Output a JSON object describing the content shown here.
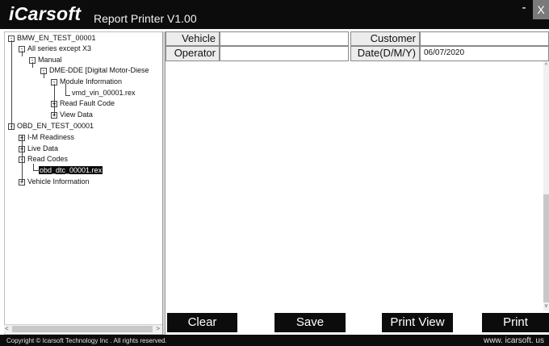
{
  "header": {
    "brand": "iCarsoft",
    "app_title": "Report Printer V1.00",
    "minimize_label": "-",
    "close_label": "X"
  },
  "tree": {
    "items": [
      {
        "label": "BMW_EN_TEST_00001",
        "toggle": "⊟"
      },
      {
        "label": "All series except X3",
        "toggle": "⊟"
      },
      {
        "label": "Manual",
        "toggle": "⊟"
      },
      {
        "label": "DME-DDE [Digital Motor-Diese",
        "toggle": "⊟"
      },
      {
        "label": "Module Information",
        "toggle": "⊟"
      },
      {
        "label": "vmd_vin_00001.rex",
        "toggle": ""
      },
      {
        "label": "Read Fault Code",
        "toggle": "⊞"
      },
      {
        "label": "View Data",
        "toggle": "⊞"
      },
      {
        "label": "OBD_EN_TEST_00001",
        "toggle": "⊟"
      },
      {
        "label": "I-M Readiness",
        "toggle": "⊞"
      },
      {
        "label": "Live Data",
        "toggle": "⊞"
      },
      {
        "label": "Read Codes",
        "toggle": "⊟"
      },
      {
        "label": "obd_dtc_00001.rex",
        "toggle": ""
      },
      {
        "label": "Vehicle Information",
        "toggle": "⊞"
      }
    ]
  },
  "form": {
    "vehicle_label": "Vehicle",
    "vehicle_value": "",
    "customer_label": "Customer",
    "customer_value": "",
    "operator_label": "Operator",
    "operator_value": "",
    "date_label": "Date(D/M/Y)",
    "date_value": "06/07/2020"
  },
  "buttons": {
    "clear": "Clear",
    "save": "Save",
    "print_view": "Print  View",
    "print": "Print"
  },
  "footer": {
    "copyright": "Copyright © Icarsoft Technology  Inc . All rights  reserved.",
    "website": "www. icarsoft. us"
  }
}
